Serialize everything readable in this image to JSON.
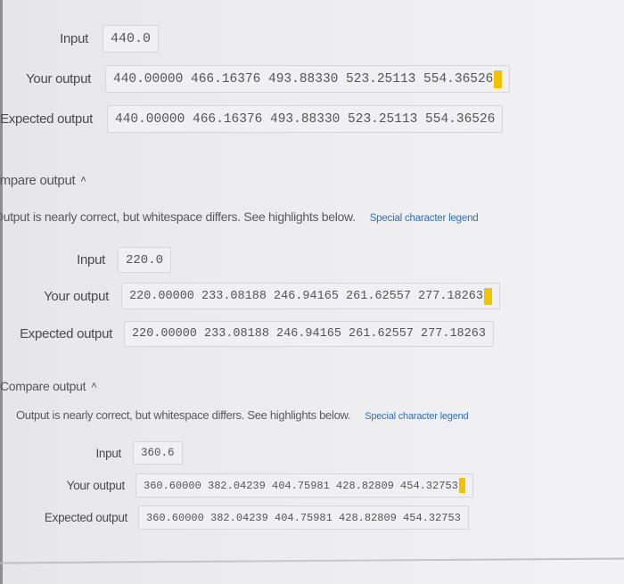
{
  "tests": [
    {
      "input_label": "Input",
      "input_value": "440.0",
      "your_output_label": "Your output",
      "your_output_value": "440.00000 466.16376 493.88330 523.25113 554.36526",
      "expected_output_label": "Expected output",
      "expected_output_value": "440.00000 466.16376 493.88330 523.25113 554.36526"
    },
    {
      "compare_title": "Compare output",
      "message": "Output is nearly correct, but whitespace differs. See highlights below.",
      "legend_link": "Special character legend",
      "input_label": "Input",
      "input_value": "220.0",
      "your_output_label": "Your output",
      "your_output_value": "220.00000 233.08188 246.94165 261.62557 277.18263",
      "expected_output_label": "Expected output",
      "expected_output_value": "220.00000 233.08188 246.94165 261.62557 277.18263"
    },
    {
      "compare_title": "Compare output",
      "message": "Output is nearly correct, but whitespace differs. See highlights below.",
      "legend_link": "Special character legend",
      "input_label": "Input",
      "input_value": "360.6",
      "your_output_label": "Your output",
      "your_output_value": "360.60000 382.04239 404.75981 428.82809 454.32753",
      "expected_output_label": "Expected output",
      "expected_output_value": "360.60000 382.04239 404.75981 428.82809 454.32753"
    }
  ],
  "colors": {
    "highlight": "#f2c100",
    "link": "#2f6fb6"
  }
}
